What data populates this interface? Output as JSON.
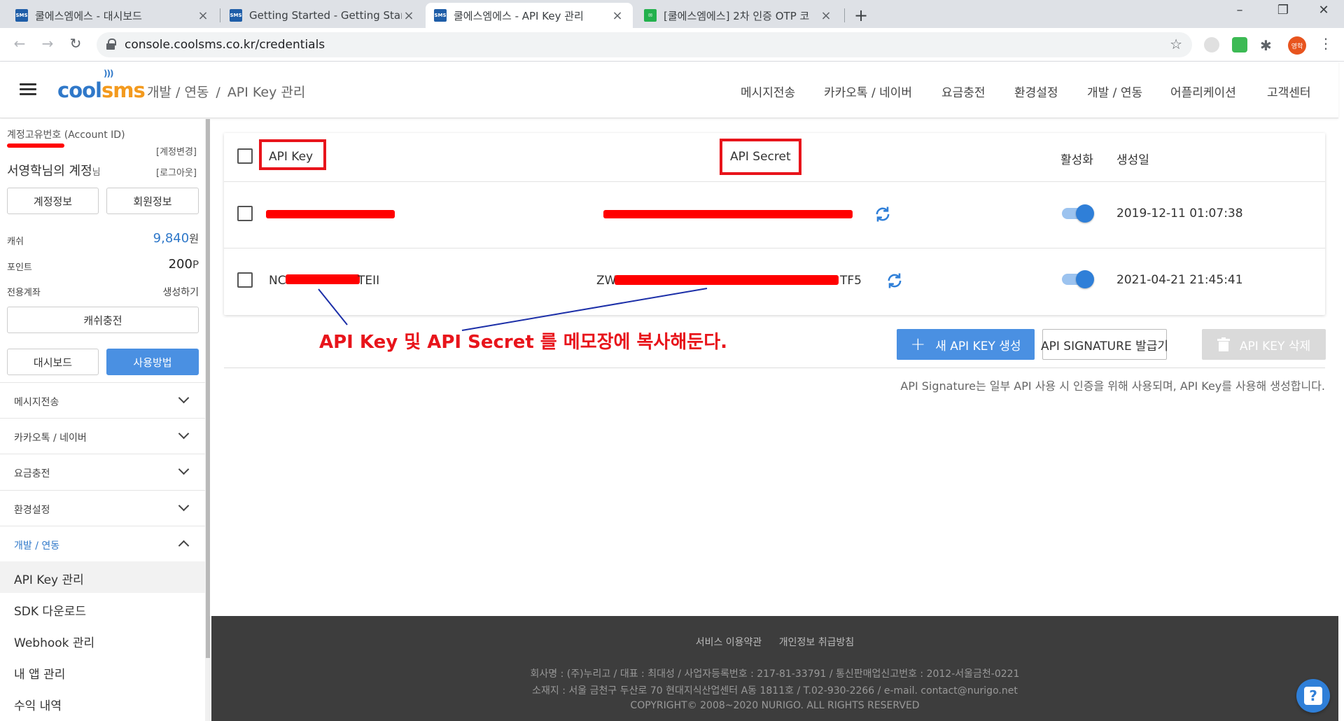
{
  "browser": {
    "tabs": [
      {
        "title": "쿨에스엠에스 - 대시보드",
        "favicon": "sms-icon"
      },
      {
        "title": "Getting Started - Getting Starte",
        "favicon": "sms-icon"
      },
      {
        "title": "쿨에스엠에스 - API Key 관리",
        "favicon": "sms-icon"
      },
      {
        "title": "[쿨에스엠에스] 2차 인증 OTP 코",
        "favicon": "mail-icon"
      }
    ],
    "active_tab": 2,
    "url": "console.coolsms.co.kr/credentials",
    "profile_initials": "영학"
  },
  "header": {
    "logo_cool": "cool",
    "logo_sms": "sms",
    "breadcrumb_parent": "개발 / 연동",
    "breadcrumb_sep": "/",
    "breadcrumb_current": "API Key 관리",
    "nav": [
      "메시지전송",
      "카카오톡 / 네이버",
      "요금충전",
      "환경설정",
      "개발 / 연동",
      "어플리케이션",
      "고객센터"
    ]
  },
  "sidebar": {
    "account_label": "계정고유번호 (Account ID)",
    "account_change": "[계정변경]",
    "account_name": "서영학님의 계정",
    "account_name_suffix": "님",
    "logout": "[로그아웃]",
    "btn_account_info": "계정정보",
    "btn_member_info": "회원정보",
    "cash_label": "캐쉬",
    "cash_value": "9,840",
    "cash_unit": "원",
    "point_label": "포인트",
    "point_value": "200",
    "point_unit": "P",
    "dedicated_account_label": "전용계좌",
    "dedicated_account_action": "생성하기",
    "btn_charge": "캐쉬충전",
    "btn_dashboard": "대시보드",
    "btn_usage": "사용방법",
    "menu": [
      "메시지전송",
      "카카오톡 / 네이버",
      "요금충전",
      "환경설정",
      "개발 / 연동"
    ],
    "submenu": [
      "API Key 관리",
      "SDK 다운로드",
      "Webhook 관리",
      "내 앱 관리",
      "수익 내역"
    ]
  },
  "table": {
    "headers": {
      "api_key": "API Key",
      "api_secret": "API Secret",
      "active": "활성화",
      "created": "생성일"
    },
    "rows": [
      {
        "key_prefix": "",
        "key_suffix": "",
        "secret_prefix": "",
        "secret_suffix": "",
        "active": true,
        "created": "2019-12-11 01:07:38"
      },
      {
        "key_prefix": "NC",
        "key_suffix": "TEII",
        "secret_prefix": "ZWS",
        "secret_suffix": "TF5",
        "active": true,
        "created": "2021-04-21 21:45:41"
      }
    ]
  },
  "annotation": "API Key 및 API Secret 를 메모장에 복사해둔다.",
  "actions": {
    "new_key": "새 API KEY 생성",
    "signature": "API SIGNATURE 발급기",
    "delete_key": "API KEY 삭제"
  },
  "signature_note": "API Signature는 일부 API 사용 시 인증을 위해 사용되며, API Key를 사용해 생성합니다.",
  "footer": {
    "terms": "서비스 이용약관",
    "privacy": "개인정보 취급방침",
    "company_line1": "회사명 : (주)누리고 / 대표 : 최대성 / 사업자등록번호 : 217-81-33791 / 통신판매업신고번호 : 2012-서울금천-0221",
    "company_line2": "소재지 : 서울 금천구 두산로 70 현대지식산업센터 A동 1811호 / T.02-930-2266 / e-mail. contact@nurigo.net",
    "copyright": "COPYRIGHT© 2008~2020 NURIGO. ALL RIGHTS RESERVED"
  },
  "colors": {
    "accent": "#4a90e2",
    "highlight": "#e8141b",
    "toggle_on": "#2f7fd8",
    "footer_bg": "#3d3d3d"
  }
}
